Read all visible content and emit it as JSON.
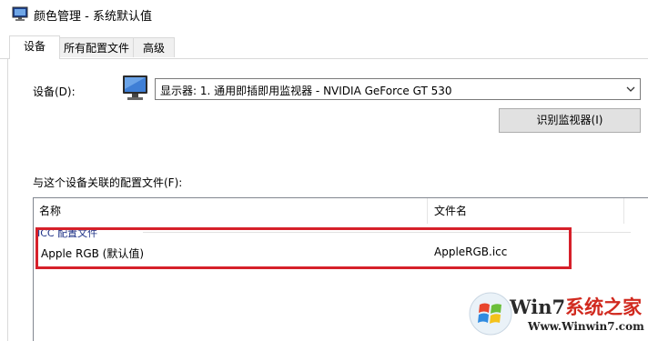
{
  "window": {
    "title": "颜色管理 - 系统默认值"
  },
  "tabs": [
    {
      "label": "设备",
      "active": true
    },
    {
      "label": "所有配置文件",
      "active": false
    },
    {
      "label": "高级",
      "active": false
    }
  ],
  "device": {
    "label": "设备(D):",
    "selected": "显示器: 1. 通用即插即用监视器 - NVIDIA GeForce GT 530",
    "identify_button": "识别监视器(I)"
  },
  "profiles": {
    "label": "与这个设备关联的配置文件(F):",
    "columns": [
      "名称",
      "文件名"
    ],
    "group": "ICC 配置文件",
    "rows": [
      {
        "name": "Apple RGB (默认值)",
        "file": "AppleRGB.icc"
      }
    ]
  },
  "watermark": {
    "brand_prefix": "Win7",
    "brand_suffix": "系统之家",
    "url": "Www.Winwin7.com"
  },
  "colors": {
    "highlight": "#d6202a",
    "group_text": "#1e3287"
  }
}
